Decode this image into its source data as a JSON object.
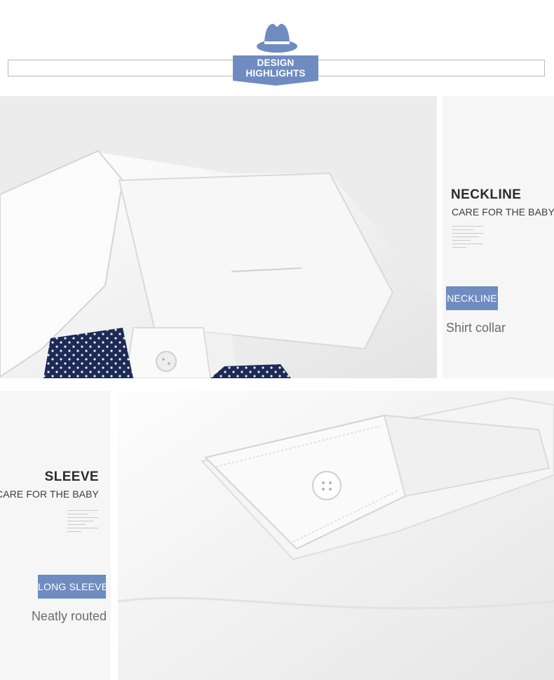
{
  "header": {
    "ribbon_line1": "DESIGN",
    "ribbon_line2": "HIGHLIGHTS",
    "hat_icon": "fedora-hat-icon",
    "accent_color": "#6f8cc0"
  },
  "features": [
    {
      "title": "NECKLINE",
      "subtitle": "CARE FOR THE BABY",
      "badge": "NECKLINE",
      "caption": "Shirt collar",
      "image": "shirt-collar-with-bow-tie-photo"
    },
    {
      "title": "SLEEVE",
      "subtitle": "CARE FOR THE BABY",
      "badge": "LONG SLEEVE",
      "caption": "Neatly routed",
      "image": "sleeve-cuff-with-button-photo"
    }
  ]
}
